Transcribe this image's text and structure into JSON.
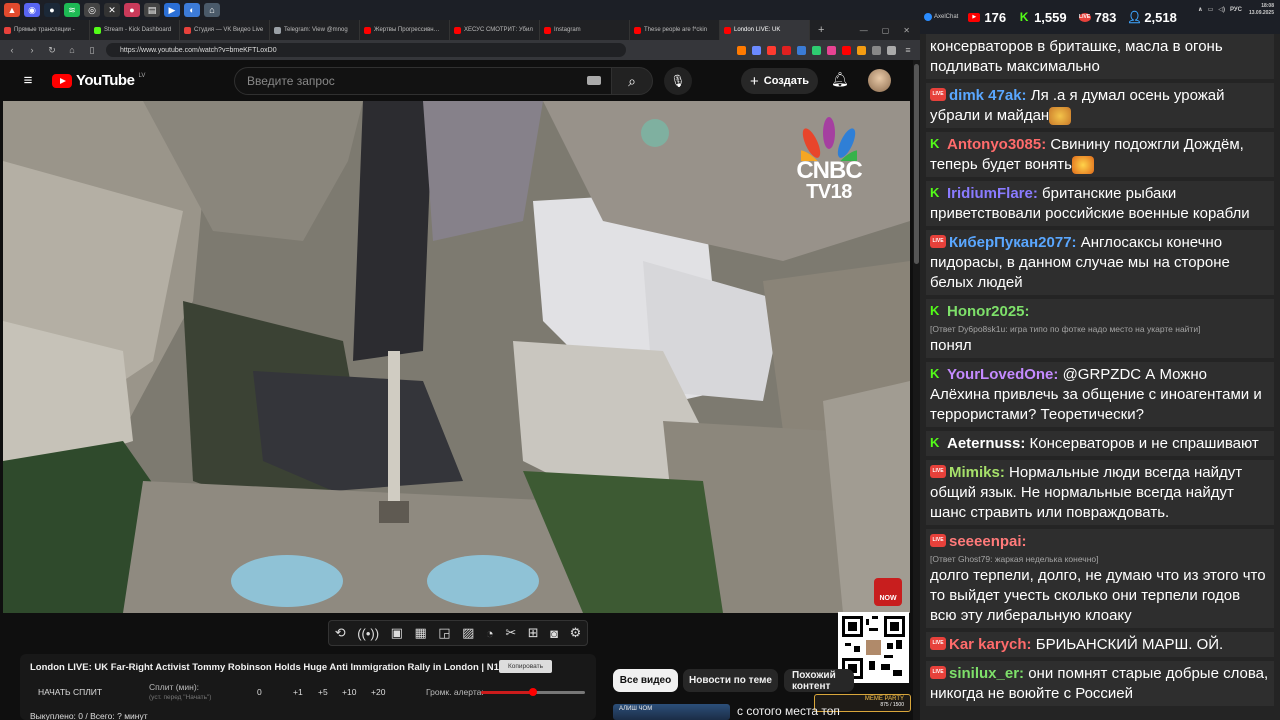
{
  "browser": {
    "tabs": [
      {
        "label": "Прямые трансляции -",
        "color": "#e7413b"
      },
      {
        "label": "Stream - Kick Dashboard",
        "color": "#53fc18"
      },
      {
        "label": "Студия — VK Видео Live",
        "color": "#e7413b"
      },
      {
        "label": "Telegram: View @mnog",
        "color": "#9aa0a6"
      },
      {
        "label": "Жертвы Прогрессивн…",
        "color": "#ff0000"
      },
      {
        "label": "ХЕСУС СМОТРИТ: Убил",
        "color": "#ff0000"
      },
      {
        "label": "Instagram",
        "color": "#ff0000"
      },
      {
        "label": "These people are f*ckin",
        "color": "#ff0000"
      },
      {
        "label": "London LIVE: UK",
        "color": "#ff0000"
      }
    ],
    "url": "https://www.youtube.com/watch?v=bmeKFTLoxD0"
  },
  "youtube": {
    "logo_text": "YouTube",
    "country": "LV",
    "search_placeholder": "Введите запрос",
    "create_label": "Создать",
    "cnbc_line1": "CNBC",
    "cnbc_line2": "TV18",
    "live_badge": "NOW"
  },
  "extension": {
    "video_title": "London LIVE: UK Far-Right Activist Tommy Robinson Holds Huge Anti Immigration Rally in London | N18G",
    "copy_label": "Копировать",
    "split_button": "НАЧАТЬ СПЛИТ",
    "split_label": "Сплит (мин):",
    "split_sub": "(уст. перед \"Начать\")",
    "split_steps": [
      "0",
      "+1",
      "+5",
      "+10",
      "+20"
    ],
    "alert_label": "Громк. алерта:",
    "alert_volume": 0.5,
    "status": "Выкуплено: 0 / Всего: ? минут"
  },
  "chips": {
    "all": "Все видео",
    "news": "Новости по теме",
    "similar": "Похожий контент"
  },
  "recommended": {
    "thumb_text": "АЛИШ ЧОМ",
    "title": "с сотого места топ"
  },
  "meme_party": {
    "label": "MEME PARTY",
    "progress": "875 / 1500"
  },
  "chat_header": {
    "app": "AxelChat",
    "youtube_count": "176",
    "kick_count": "1,559",
    "vk_count": "783",
    "viewers": "2,518",
    "lang": "РУС",
    "time": "18:08",
    "date": "13.09.2025"
  },
  "chat": [
    {
      "platform": "none",
      "user": "",
      "user_color": "#ffffff",
      "reply": "",
      "text": "консерваторов в бриташке, масла в огонь подливать максимально"
    },
    {
      "platform": "vk",
      "user": "dimk 47ak:",
      "user_color": "#5aa7ff",
      "reply": "",
      "text": "Ля .а я думал осень урожай убрали и майдан"
    },
    {
      "platform": "kick",
      "user": "Antonyo3085:",
      "user_color": "#ff6b6b",
      "reply": "",
      "text": "Свинину подожгли Дождём, теперь будет вонять"
    },
    {
      "platform": "kick",
      "user": "IridiumFlare:",
      "user_color": "#8a7bff",
      "reply": "",
      "text": "британские рыбаки приветствовали российские военные корабли"
    },
    {
      "platform": "vk",
      "user": "КиберПукан2077:",
      "user_color": "#5aa7ff",
      "reply": "",
      "text": "Англосаксы конечно пидорасы, в данном случае мы на стороне белых людей"
    },
    {
      "platform": "kick",
      "user": "Honor2025:",
      "user_color": "#7ee06a",
      "reply": "[Ответ Dy6po8sk1u: игра типо по фотке надо место на укарте найти]",
      "text": "понял"
    },
    {
      "platform": "kick",
      "user": "YourLovedOne:",
      "user_color": "#c48aff",
      "reply": "",
      "text": "@GRPZDC А Можно Алёхина привлечь за общение с иноагентами и террористами? Теоретически?"
    },
    {
      "platform": "kick",
      "user": "Aeternuss:",
      "user_color": "#ffffff",
      "reply": "",
      "text": "Консерваторов и не спрашивают"
    },
    {
      "platform": "vk",
      "user": "Mimiks:",
      "user_color": "#a6e06a",
      "reply": "",
      "text": "Нормальные люди всегда найдут общий язык. Не нормальные всегда найдут шанс стравить или повраждовать."
    },
    {
      "platform": "vk",
      "user": "seeeenpai:",
      "user_color": "#ff7a7a",
      "reply": "[Ответ Ghost79: жаркая неделька конечно]",
      "text": "долго терпели, долго, не думаю что из этого что то выйдет учесть сколько они терпели годов всю эту либеральную клоаку"
    },
    {
      "platform": "vk",
      "user": "Kar karych:",
      "user_color": "#ff6b6b",
      "reply": "",
      "text": "БРИЬАНСКИЙ МАРШ. ОЙ."
    },
    {
      "platform": "vk",
      "user": "sinilux_er:",
      "user_color": "#7ee06a",
      "reply": "",
      "text": "они помнят старые добрые слова, никогда не воюйте с Россией"
    }
  ]
}
